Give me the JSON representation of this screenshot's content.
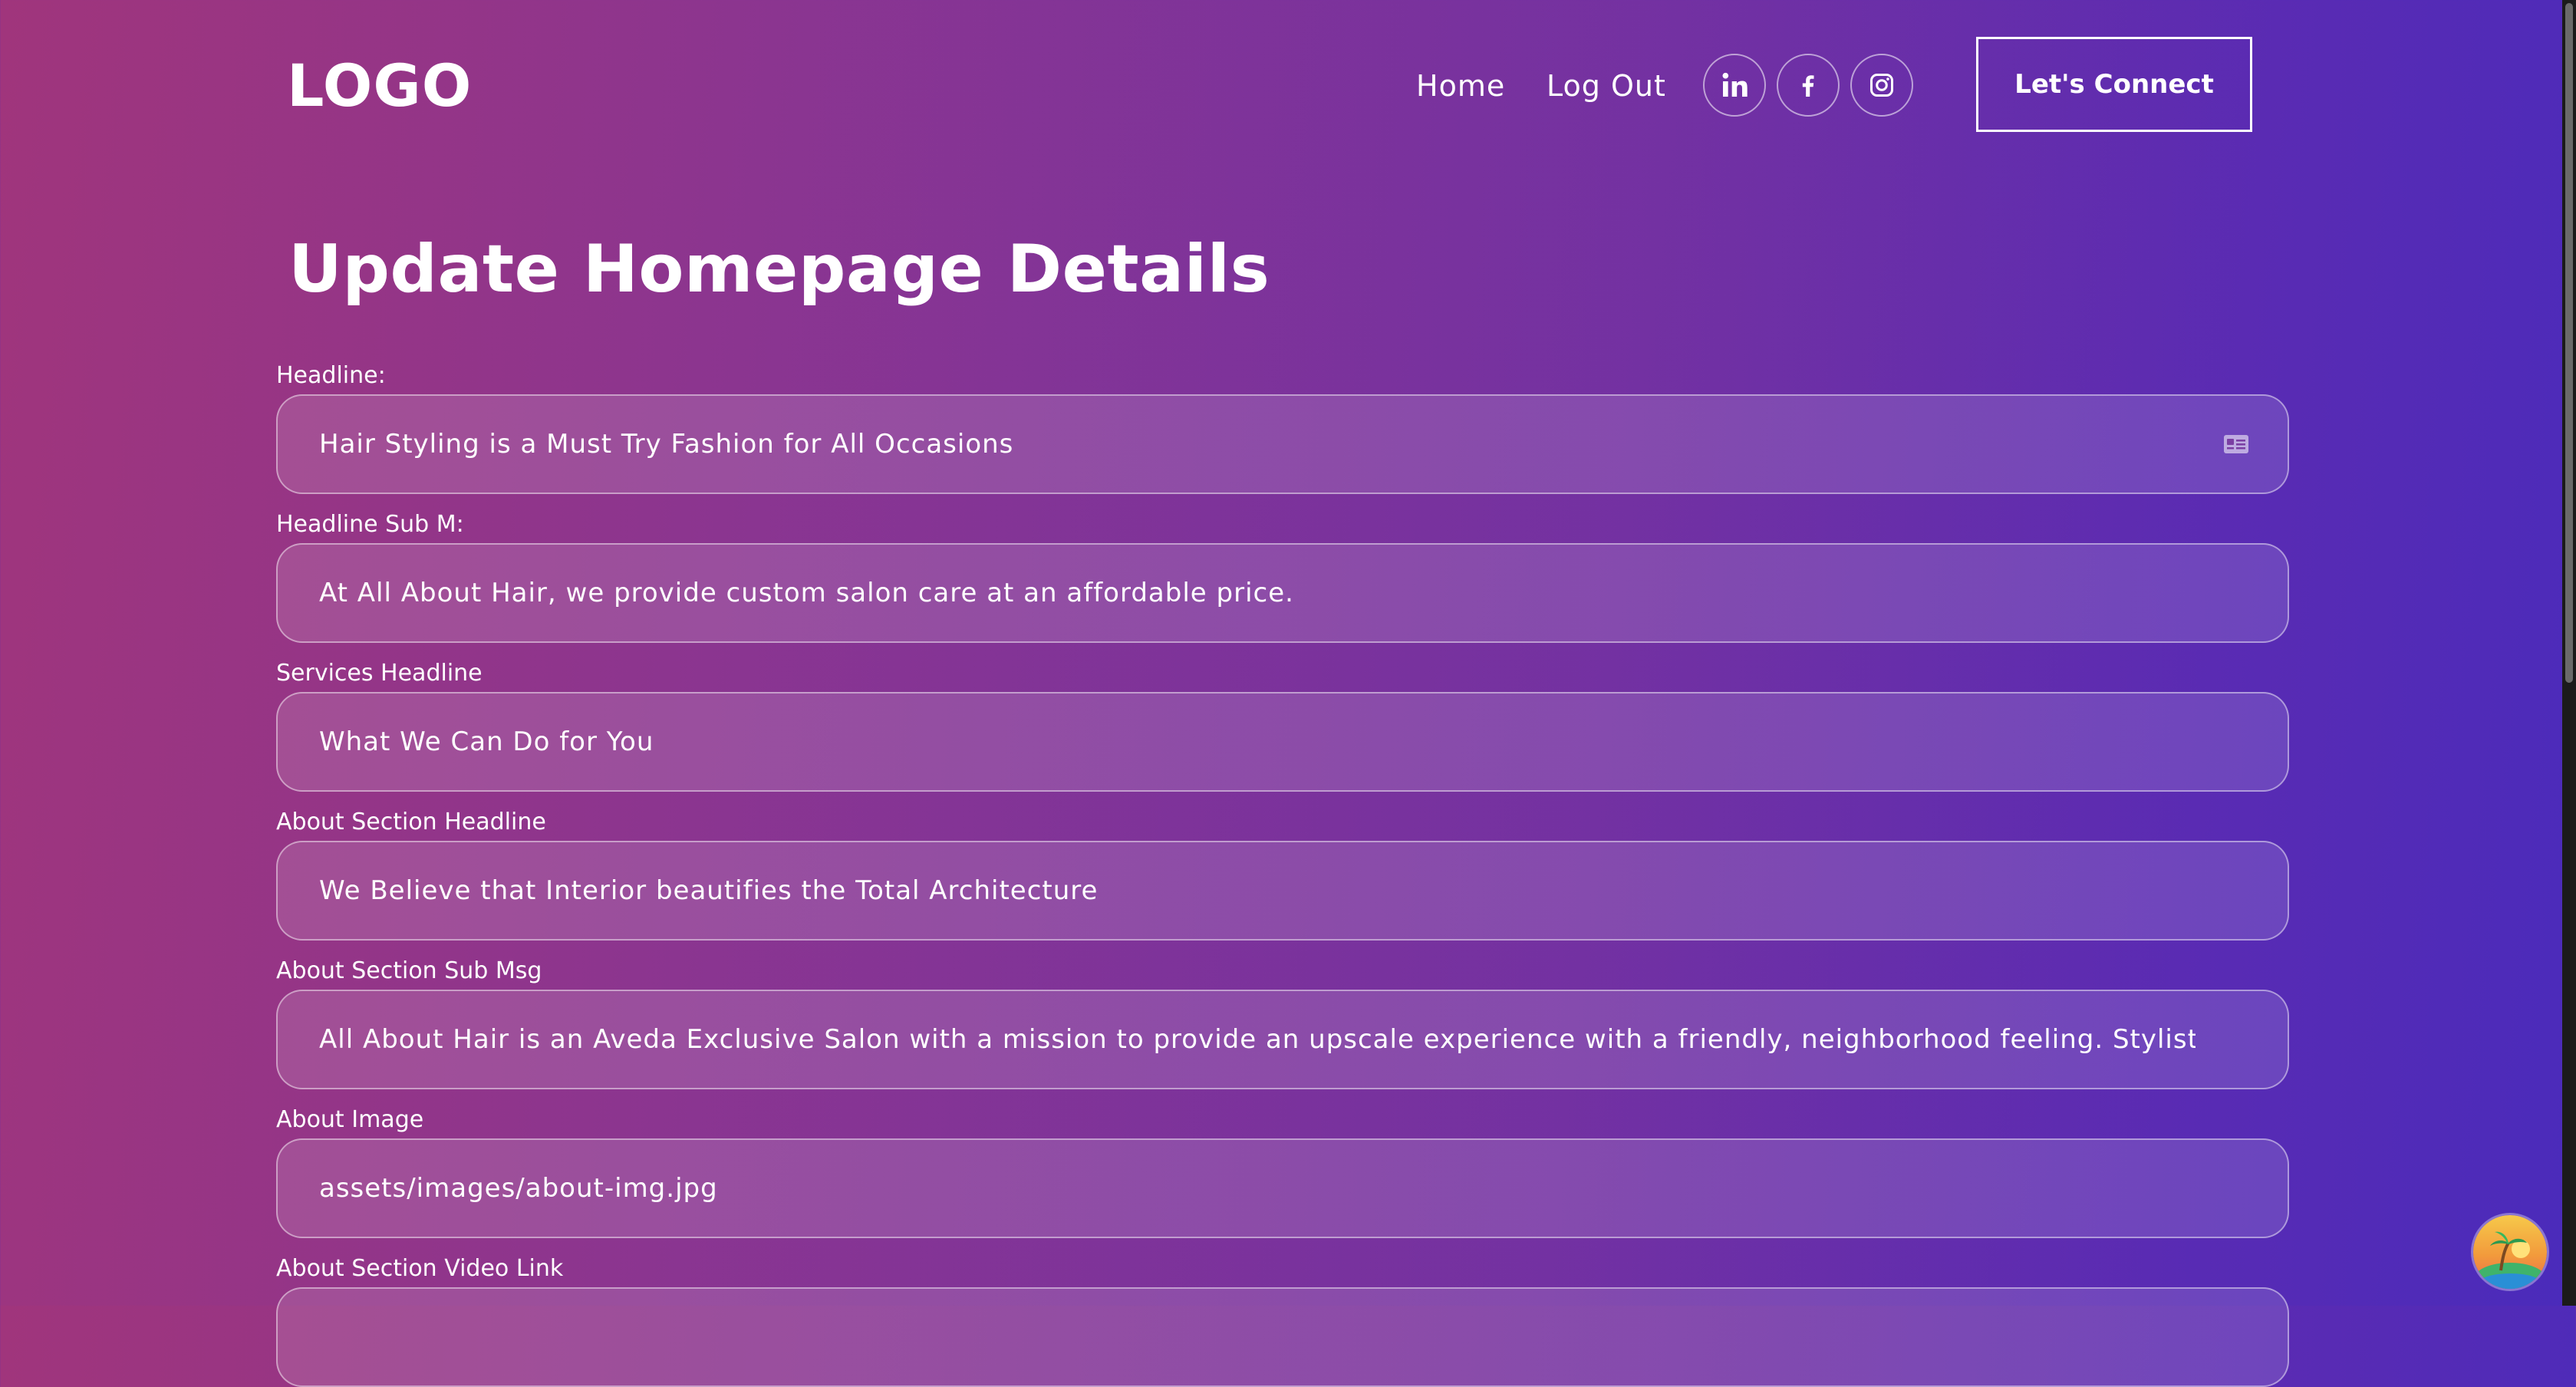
{
  "header": {
    "logo": "LOGO",
    "nav": {
      "home": "Home",
      "logout": "Log Out"
    },
    "social_icons": [
      "linkedin-icon",
      "facebook-icon",
      "instagram-icon"
    ],
    "cta": "Let's Connect"
  },
  "page_title": "Update Homepage Details",
  "form": {
    "fields": [
      {
        "label": "Headline:",
        "value": "Hair Styling is a Must Try Fashion for All Occasions"
      },
      {
        "label": "Headline Sub M:",
        "value": "At All About Hair, we provide custom salon care at an affordable price."
      },
      {
        "label": "Services Headline",
        "value": "What We Can Do for You"
      },
      {
        "label": "About Section Headline",
        "value": "We Believe that Interior beautifies the Total Architecture"
      },
      {
        "label": "About Section Sub Msg",
        "value": "All About Hair is an Aveda Exclusive Salon with a mission to provide an upscale experience with a friendly, neighborhood feeling. Stylists l"
      },
      {
        "label": "About Image",
        "value": "assets/images/about-img.jpg"
      },
      {
        "label": "About Section Video Link",
        "value": ""
      }
    ]
  },
  "colors": {
    "gradient_start": "#a0357c",
    "gradient_end": "#4a2bbb",
    "text": "#ffffff"
  }
}
